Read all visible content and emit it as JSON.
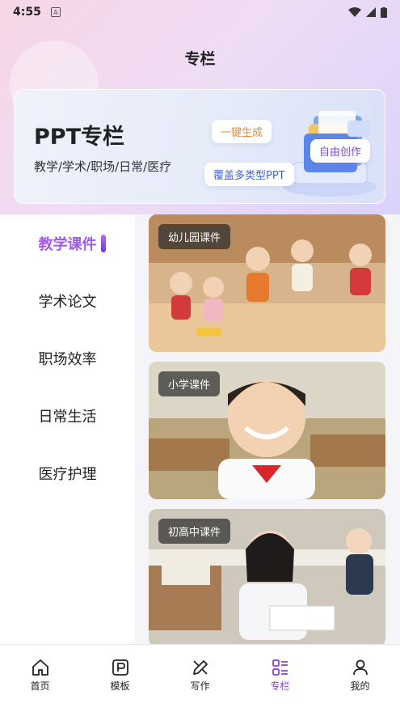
{
  "status_bar": {
    "time": "4:55",
    "notification_glyph": "A"
  },
  "header": {
    "title": "专栏"
  },
  "banner": {
    "title": "PPT专栏",
    "subtitle": "教学/学术/职场/日常/医疗",
    "tags": [
      "一键生成",
      "自由创作",
      "覆盖多类型PPT"
    ]
  },
  "sidebar": {
    "items": [
      {
        "label": "教学课件",
        "active": true
      },
      {
        "label": "学术论文",
        "active": false
      },
      {
        "label": "职场效率",
        "active": false
      },
      {
        "label": "日常生活",
        "active": false
      },
      {
        "label": "医疗护理",
        "active": false
      }
    ]
  },
  "cards": [
    {
      "label": "幼儿园课件"
    },
    {
      "label": "小学课件"
    },
    {
      "label": "初高中课件"
    }
  ],
  "tabbar": {
    "items": [
      {
        "label": "首页",
        "icon": "home-icon"
      },
      {
        "label": "模板",
        "icon": "template-icon"
      },
      {
        "label": "写作",
        "icon": "pen-icon"
      },
      {
        "label": "专栏",
        "icon": "column-icon",
        "active": true
      },
      {
        "label": "我的",
        "icon": "profile-icon"
      }
    ]
  },
  "colors": {
    "accent": "#8a3ee6",
    "active_side": "#a05be8"
  }
}
